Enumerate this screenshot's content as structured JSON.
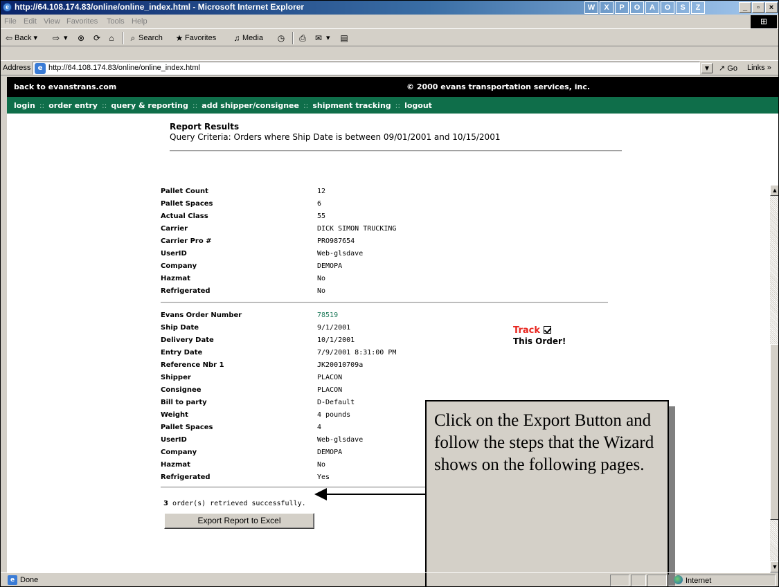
{
  "window": {
    "title": "http://64.108.174.83/online/online_index.html - Microsoft Internet Explorer",
    "tray_icons": [
      "W",
      "X",
      "P",
      "O",
      "A",
      "O",
      "S",
      "Z"
    ]
  },
  "menubar": {
    "items": [
      "File",
      "Edit",
      "View",
      "Favorites",
      "Tools",
      "Help"
    ]
  },
  "toolbar": {
    "back": "Back",
    "search": "Search",
    "favorites": "Favorites",
    "media": "Media"
  },
  "address": {
    "label": "Address",
    "url": "http://64.108.174.83/online/online_index.html",
    "go": "Go",
    "links": "Links »"
  },
  "site": {
    "back_link": "back to evanstrans.com",
    "copyright": "© 2000 evans transportation services, inc.",
    "nav": [
      "login",
      "order entry",
      "query & reporting",
      "add shipper/consignee",
      "shipment tracking",
      "logout"
    ],
    "nav_sep": "::"
  },
  "report": {
    "title": "Report Results",
    "criteria": "Query Criteria: Orders where Ship Date is between 09/01/2001 and 10/15/2001"
  },
  "order_prev": [
    {
      "label": "Pallet Count",
      "value": "12"
    },
    {
      "label": "Pallet Spaces",
      "value": "6"
    },
    {
      "label": "Actual Class",
      "value": "55"
    },
    {
      "label": "Carrier",
      "value": "DICK SIMON TRUCKING"
    },
    {
      "label": "Carrier Pro #",
      "value": "PRO987654"
    },
    {
      "label": "UserID",
      "value": "Web-glsdave"
    },
    {
      "label": "Company",
      "value": "DEMOPA"
    },
    {
      "label": "Hazmat",
      "value": "No"
    },
    {
      "label": "Refrigerated",
      "value": "No"
    }
  ],
  "order_current": [
    {
      "label": "Evans Order Number",
      "value": "78519"
    },
    {
      "label": "Ship Date",
      "value": "9/1/2001"
    },
    {
      "label": "Delivery Date",
      "value": "10/1/2001"
    },
    {
      "label": "Entry Date",
      "value": "7/9/2001 8:31:00 PM"
    },
    {
      "label": "Reference Nbr 1",
      "value": "JK20010709a"
    },
    {
      "label": "Shipper",
      "value": "PLACON"
    },
    {
      "label": "Consignee",
      "value": "PLACON"
    },
    {
      "label": "Bill to party",
      "value": "D-Default"
    },
    {
      "label": "Weight",
      "value": "4 pounds"
    },
    {
      "label": "Pallet Spaces",
      "value": "4"
    },
    {
      "label": "UserID",
      "value": "Web-glsdave"
    },
    {
      "label": "Company",
      "value": "DEMOPA"
    },
    {
      "label": "Hazmat",
      "value": "No"
    },
    {
      "label": "Refrigerated",
      "value": "Yes"
    }
  ],
  "track": {
    "word": "Track",
    "this_order": "This Order!",
    "checked": true
  },
  "summary": {
    "count": "3",
    "text": "order(s) retrieved successfully."
  },
  "export_button": "Export Report to Excel",
  "callout": "Click on the Export Button and follow the steps that the Wizard shows on the following pages.",
  "status": {
    "text": "Done",
    "zone": "Internet"
  }
}
